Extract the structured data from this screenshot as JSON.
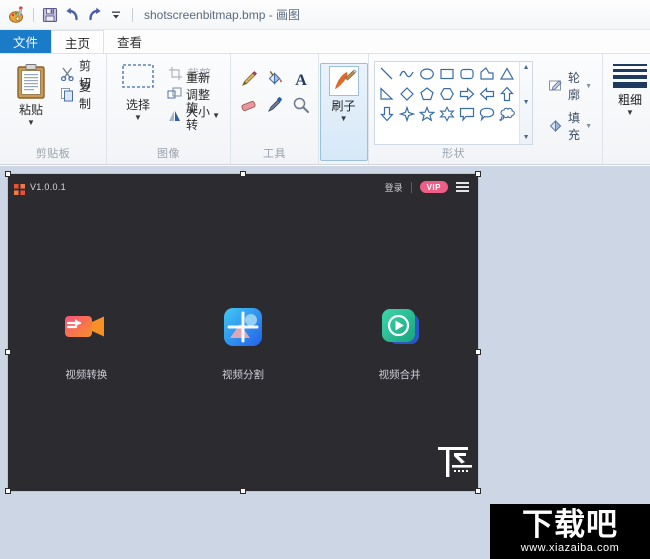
{
  "window": {
    "title": "shotscreenbitmap.bmp - 画图",
    "quick_access": [
      {
        "name": "paint-app-icon",
        "glyph": "palette"
      },
      {
        "name": "save-icon",
        "glyph": "floppy"
      },
      {
        "name": "undo-icon",
        "glyph": "undo"
      },
      {
        "name": "redo-icon",
        "glyph": "redo"
      },
      {
        "name": "customize-qat-icon",
        "glyph": "caret-down-bar"
      }
    ]
  },
  "tabs": [
    {
      "label": "文件",
      "id": "tab-file"
    },
    {
      "label": "主页",
      "id": "tab-home"
    },
    {
      "label": "查看",
      "id": "tab-view"
    }
  ],
  "ribbon": {
    "clipboard": {
      "label": "剪贴板",
      "paste": "粘贴",
      "cut": "剪切",
      "copy": "复制"
    },
    "image": {
      "label": "图像",
      "select": "选择",
      "crop": "裁剪",
      "resize": "重新调整大小",
      "rotate": "旋转"
    },
    "tools": {
      "label": "工具",
      "items": [
        {
          "name": "pencil-icon"
        },
        {
          "name": "fill-bucket-icon"
        },
        {
          "name": "text-icon"
        },
        {
          "name": "eraser-icon"
        },
        {
          "name": "color-picker-icon"
        },
        {
          "name": "magnifier-icon"
        }
      ]
    },
    "brushes": {
      "label": "刷子"
    },
    "shapes": {
      "label": "形状",
      "items": [
        "line",
        "curve",
        "oval",
        "rectangle",
        "rounded-rectangle",
        "polygon",
        "triangle",
        "right-triangle",
        "diamond",
        "pentagon",
        "hexagon",
        "right-arrow",
        "left-arrow",
        "up-arrow",
        "down-arrow",
        "four-point-star",
        "five-point-star",
        "six-point-star",
        "rect-callout",
        "rounded-callout",
        "cloud-callout"
      ]
    },
    "styles": {
      "outline": "轮廓",
      "fill": "填充"
    },
    "thickness": {
      "label": "粗细"
    }
  },
  "embedded_app": {
    "version": "V1.0.0.1",
    "login": "登录",
    "vip_badge": "VIP",
    "tiles": [
      {
        "label": "视频转换",
        "icon": "video-camera-icon"
      },
      {
        "label": "视频分割",
        "icon": "video-split-icon"
      },
      {
        "label": "视频合并",
        "icon": "video-merge-icon"
      }
    ]
  },
  "watermark": {
    "text": "下载吧",
    "url": "www.xiazaiba.com"
  },
  "colors": {
    "tab_active": "#1a7bc9",
    "vip_pill": "#ef5e86",
    "canvas_bg": "#ccd6e4",
    "image_bg": "#2b2b30"
  }
}
